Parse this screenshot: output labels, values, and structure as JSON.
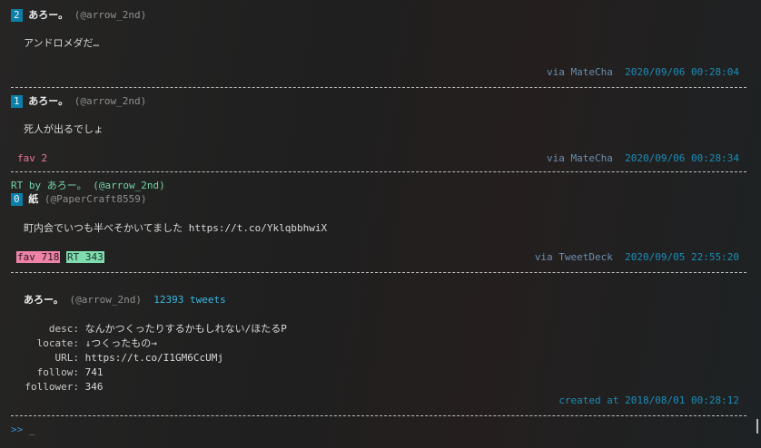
{
  "tweets": [
    {
      "index": "2",
      "name": "あろー。",
      "screen_name": "(@arrow_2nd)",
      "text": "アンドロメダだ…",
      "via": "via MateCha",
      "time": "2020/09/06 00:28:04"
    },
    {
      "index": "1",
      "name": "あろー。",
      "screen_name": "(@arrow_2nd)",
      "text": "死人が出るでしょ",
      "fav": "fav 2",
      "via": "via MateCha",
      "time": "2020/09/06 00:28:34"
    },
    {
      "rt_by": "RT by あろー。 (@arrow_2nd)",
      "index": "0",
      "name": "紙",
      "screen_name": "(@PaperCraft8559)",
      "text": "町内会でいつも半べそかいてました https://t.co/YklqbbhwiX",
      "fav": "fav 718",
      "rt": "RT 343",
      "via": "via TweetDeck",
      "time": "2020/09/05 22:55:20"
    }
  ],
  "profile": {
    "name": "あろー。",
    "screen_name": "(@arrow_2nd)",
    "tweets": "12393 tweets",
    "fields": [
      {
        "key": "desc:",
        "value": "なんかつくったりするかもしれない/ほたるP"
      },
      {
        "key": "locate:",
        "value": "↓つくったもの→"
      },
      {
        "key": "URL:",
        "value": "https://t.co/I1GM6CcUMj"
      },
      {
        "key": "follow:",
        "value": "741"
      },
      {
        "key": "follower:",
        "value": "346"
      }
    ],
    "created": "created at 2018/08/01 00:28:12"
  },
  "prompt": {
    "symbol": ">>",
    "cursor": "_"
  }
}
